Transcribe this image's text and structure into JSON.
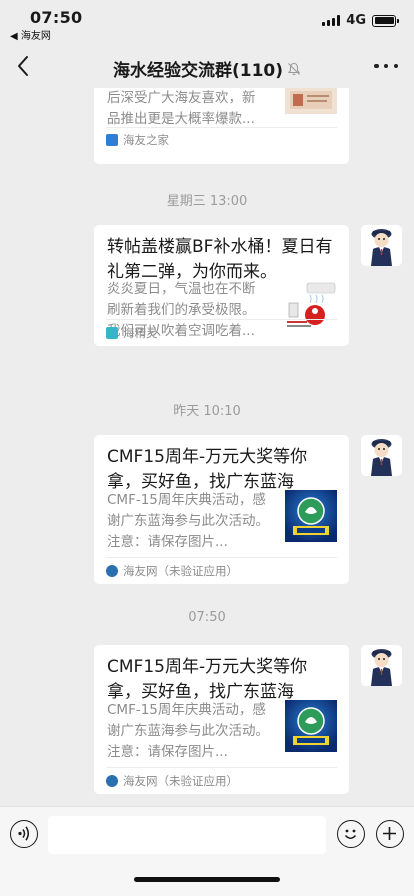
{
  "status_bar": {
    "time": "07:50",
    "back_app": "◀ 海友网",
    "network": "4G"
  },
  "nav": {
    "title": "海水经验交流群(110)"
  },
  "messages": [
    {
      "desc_partial": "后深受广大海友喜欢，新品推出更是大概率爆款...",
      "source": "海友之家",
      "source_color": "#2f7fd6"
    },
    {
      "timestamp": "星期三 13:00",
      "title": "转帖盖楼赢BF补水桶！夏日有礼第二弹，为你而来。",
      "desc": "炎炎夏日，气温也在不断刷新着我们的承受极限。我们可以吹着空调吃着...",
      "source": "海精灵",
      "source_color": "#35b6c8"
    },
    {
      "timestamp": "昨天 10:10",
      "title": "CMF15周年-万元大奖等你拿，买好鱼，找广东蓝海",
      "desc": "CMF-15周年庆典活动，感谢广东蓝海参与此次活动。注意：请保存图片...",
      "source": "海友网（未验证应用）",
      "source_color": "#2a6fb0"
    },
    {
      "timestamp": "07:50",
      "title": "CMF15周年-万元大奖等你拿，买好鱼，找广东蓝海",
      "desc": "CMF-15周年庆典活动，感谢广东蓝海参与此次活动。注意：请保存图片...",
      "source": "海友网（未验证应用）",
      "source_color": "#2a6fb0"
    }
  ],
  "icons": {
    "back": "chevron-left-icon",
    "mute": "bell-off-icon",
    "more": "more-icon",
    "voice": "voice-icon",
    "emoji": "emoji-icon",
    "plus": "plus-icon"
  }
}
